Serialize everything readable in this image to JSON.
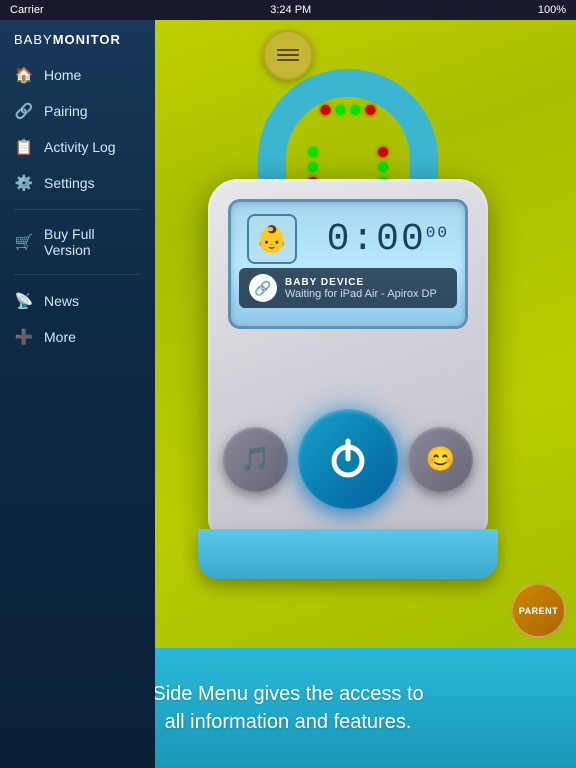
{
  "statusBar": {
    "carrier": "Carrier",
    "time": "3:24 PM",
    "battery": "100%",
    "wifi": "WiFi"
  },
  "appTitle": {
    "baby": "BABY",
    "monitor": "MONITOR"
  },
  "sidebar": {
    "items": [
      {
        "id": "home",
        "label": "Home",
        "icon": "🏠"
      },
      {
        "id": "pairing",
        "label": "Pairing",
        "icon": "🔗"
      },
      {
        "id": "activity-log",
        "label": "Activity Log",
        "icon": "📋"
      },
      {
        "id": "settings",
        "label": "Settings",
        "icon": "⚙️"
      },
      {
        "id": "buy-full",
        "label": "Buy Full Version",
        "icon": "🛒"
      },
      {
        "id": "news",
        "label": "News",
        "icon": "📡"
      },
      {
        "id": "more",
        "label": "More",
        "icon": "➕"
      }
    ]
  },
  "device": {
    "timer": "0:00",
    "timerSeconds": "00",
    "deviceTitle": "BABY DEVICE",
    "deviceStatus": "Waiting for iPad Air - Apirox DP",
    "babyIcon": "👶",
    "musicNote": "🎵",
    "smileFace": "😊"
  },
  "menuButton": {
    "ariaLabel": "Open Menu"
  },
  "parentBadge": {
    "label": "PARENT"
  },
  "bottomCaption": {
    "line1": "Side Menu gives the access to",
    "line2": "all information and features."
  }
}
